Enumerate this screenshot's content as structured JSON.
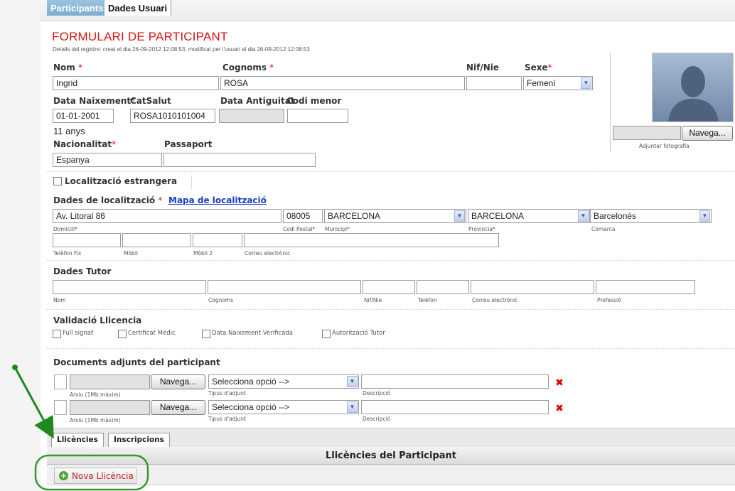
{
  "tabs": {
    "participants": "Participants",
    "user_data": "Dades Usuari"
  },
  "form": {
    "title": "FORMULARI DE PARTICIPANT",
    "subtitle": "Detalls del registre: creat el dia 26-09-2012 12:08:53, modificat per l'usuari el dia 26-09-2012 12:08:53",
    "labels": {
      "nom": "Nom",
      "cognoms": "Cognoms",
      "nif": "Nif/Nie",
      "sexe": "Sexe",
      "data_naixement": "Data Naixement",
      "catsalut": "CatSalut",
      "data_antiguitat": "Data Antiguitat",
      "codi_menor": "Codi menor",
      "nacionalitat": "Nacionalitat",
      "passaport": "Passaport",
      "localitzacio_estrangera": "Localització estrangera",
      "dades_localitzacio": "Dades de localització",
      "mapa": "Mapa de localització",
      "domicili": "Domicili",
      "codi_postal": "Codi Postal",
      "municipi": "Municipi",
      "provincia": "Provincia",
      "comarca": "Comarca",
      "telefon_fix": "Telèfon Fix",
      "mobil": "Mòbil",
      "mobil2": "Mòbil 2",
      "correu": "Correu electrònic"
    },
    "values": {
      "nom": "Ingrid",
      "cognoms": "ROSA",
      "nif": "",
      "sexe": "Femení",
      "data_naixement": "01-01-2001",
      "catsalut": "ROSA1010101004",
      "data_antiguitat": "",
      "codi_menor": "",
      "age": "11 anys",
      "nacionalitat": "Espanya",
      "passaport": "",
      "domicili": "Av. Litoral 86",
      "codi_postal": "08005",
      "municipi": "BARCELONA",
      "provincia": "BARCELONA",
      "comarca": "Barcelonès"
    }
  },
  "photo": {
    "browse": "Navega...",
    "caption": "Adjuntar fotografia"
  },
  "tutor": {
    "title": "Dades Tutor",
    "labels": {
      "nom": "Nom",
      "cognoms": "Cognoms",
      "nif": "Nif/Nie",
      "telefon": "Telèfon",
      "correu": "Correu electrònic",
      "professio": "Professió"
    }
  },
  "validacio": {
    "title": "Validació Llicencia",
    "items": [
      "Full signat",
      "Certificat Mèdic",
      "Data Naixement Verificada",
      "Autorització Tutor"
    ]
  },
  "documents": {
    "title": "Documents adjunts del participant",
    "browse": "Navega...",
    "file_hint": "Arxiu (1Mb màxim)",
    "select_value": "Selecciona opció -->",
    "type_label": "Tipus d'adjunt",
    "desc_label": "Descripció"
  },
  "bottom_tabs": {
    "llicencies": "Llicències",
    "inscripcions": "Inscripcions"
  },
  "llicencies": {
    "header": "Llicències del Participant",
    "new_button": "Nova Llicència"
  },
  "colors": {
    "accent_red": "#d51313",
    "tab_active": "#7aaed0",
    "annotation_green": "#1e8a1e"
  }
}
